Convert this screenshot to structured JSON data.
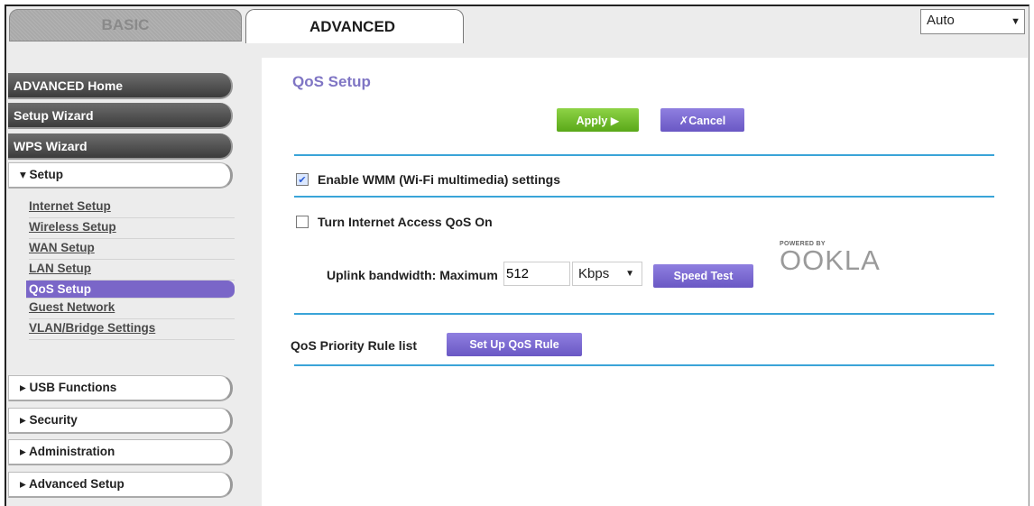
{
  "tabs": {
    "basic": "BASIC",
    "advanced": "ADVANCED"
  },
  "language": {
    "selected": "Auto"
  },
  "nav": {
    "top_items": [
      "ADVANCED Home",
      "Setup Wizard",
      "WPS Wizard"
    ],
    "setup": {
      "label": "▾ Setup",
      "links": [
        "Internet Setup",
        "Wireless Setup",
        "WAN Setup",
        "LAN Setup",
        "QoS Setup",
        "Guest Network",
        "VLAN/Bridge Settings"
      ],
      "active": "QoS Setup"
    },
    "sections": [
      "▸ USB Functions",
      "▸ Security",
      "▸ Administration",
      "▸ Advanced Setup"
    ]
  },
  "main": {
    "title": "QoS Setup",
    "apply_label": "Apply ▶",
    "cancel_label": "✗Cancel",
    "wmm": {
      "label": "Enable WMM (Wi-Fi multimedia) settings",
      "checked": true
    },
    "internet_qos": {
      "label": "Turn Internet Access QoS On",
      "checked": false
    },
    "uplink": {
      "label": "Uplink bandwidth: Maximum",
      "value": "512",
      "unit": "Kbps"
    },
    "speed_test_label": "Speed Test",
    "ookla": {
      "powered_by": "POWERED BY",
      "brand": "OOKLA"
    },
    "rule_list_label": "QoS Priority Rule list",
    "setup_rule_label": "Set Up QoS Rule"
  },
  "colors": {
    "accent_purple": "#7a66c8",
    "apply_green": "#6cbc2a",
    "rule_blue": "#3aa4d8"
  }
}
